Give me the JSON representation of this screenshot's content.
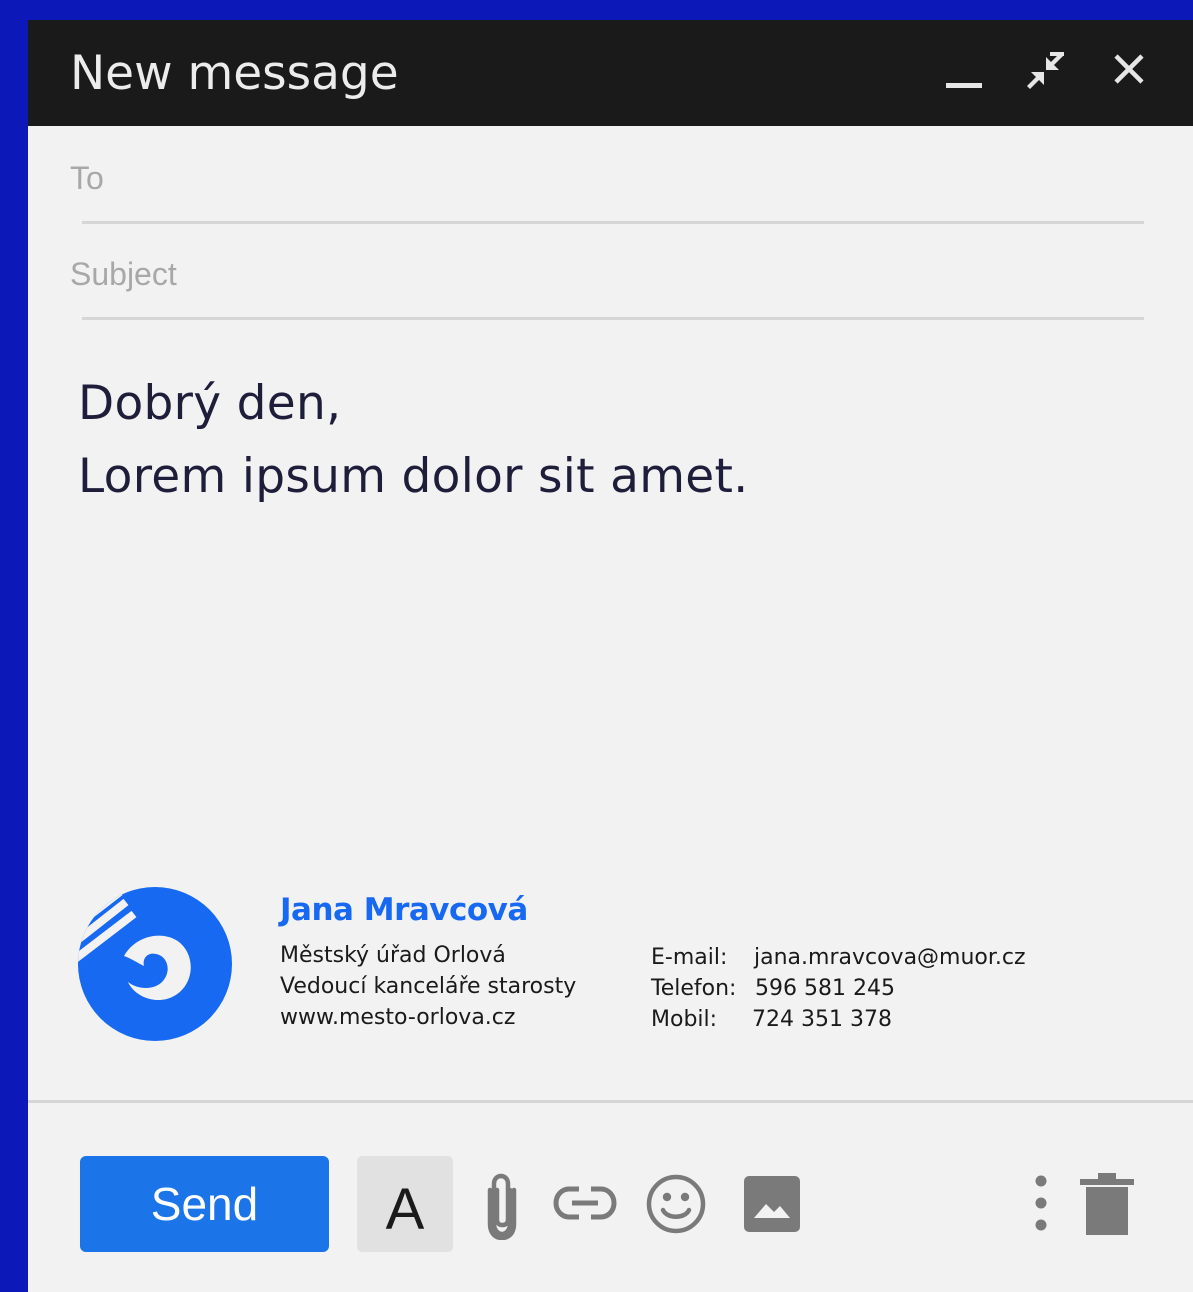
{
  "window": {
    "title": "New message"
  },
  "titlebar": {
    "minimize_icon": "minimize-icon",
    "exit_fullscreen_icon": "exit-fullscreen-icon",
    "close_icon": "close-icon"
  },
  "fields": {
    "to_placeholder": "To",
    "to_value": "",
    "subject_placeholder": "Subject",
    "subject_value": ""
  },
  "body": {
    "lines": [
      "Dobrý den,",
      "Lorem ipsum dolor sit amet."
    ]
  },
  "signature": {
    "name": "Jana Mravcová",
    "lines": [
      "Městský úřad Orlová",
      "Vedoucí kanceláře starosty",
      "www.mesto-orlova.cz"
    ],
    "contacts": {
      "email_label": "E-mail:",
      "email_value": "jana.mravcova@muor.cz",
      "phone_label": "Telefon:",
      "phone_value": "596 581 245",
      "mobile_label": "Mobil:",
      "mobile_value": "724 351 378"
    },
    "logo": "orlova-logo",
    "brand_color": "#1669f0"
  },
  "toolbar": {
    "send_label": "Send",
    "format_label": "A",
    "icons": [
      "attach-icon",
      "link-icon",
      "emoji-icon",
      "photo-icon",
      "more-options-icon",
      "trash-icon"
    ],
    "send_color": "#1b74e8"
  }
}
